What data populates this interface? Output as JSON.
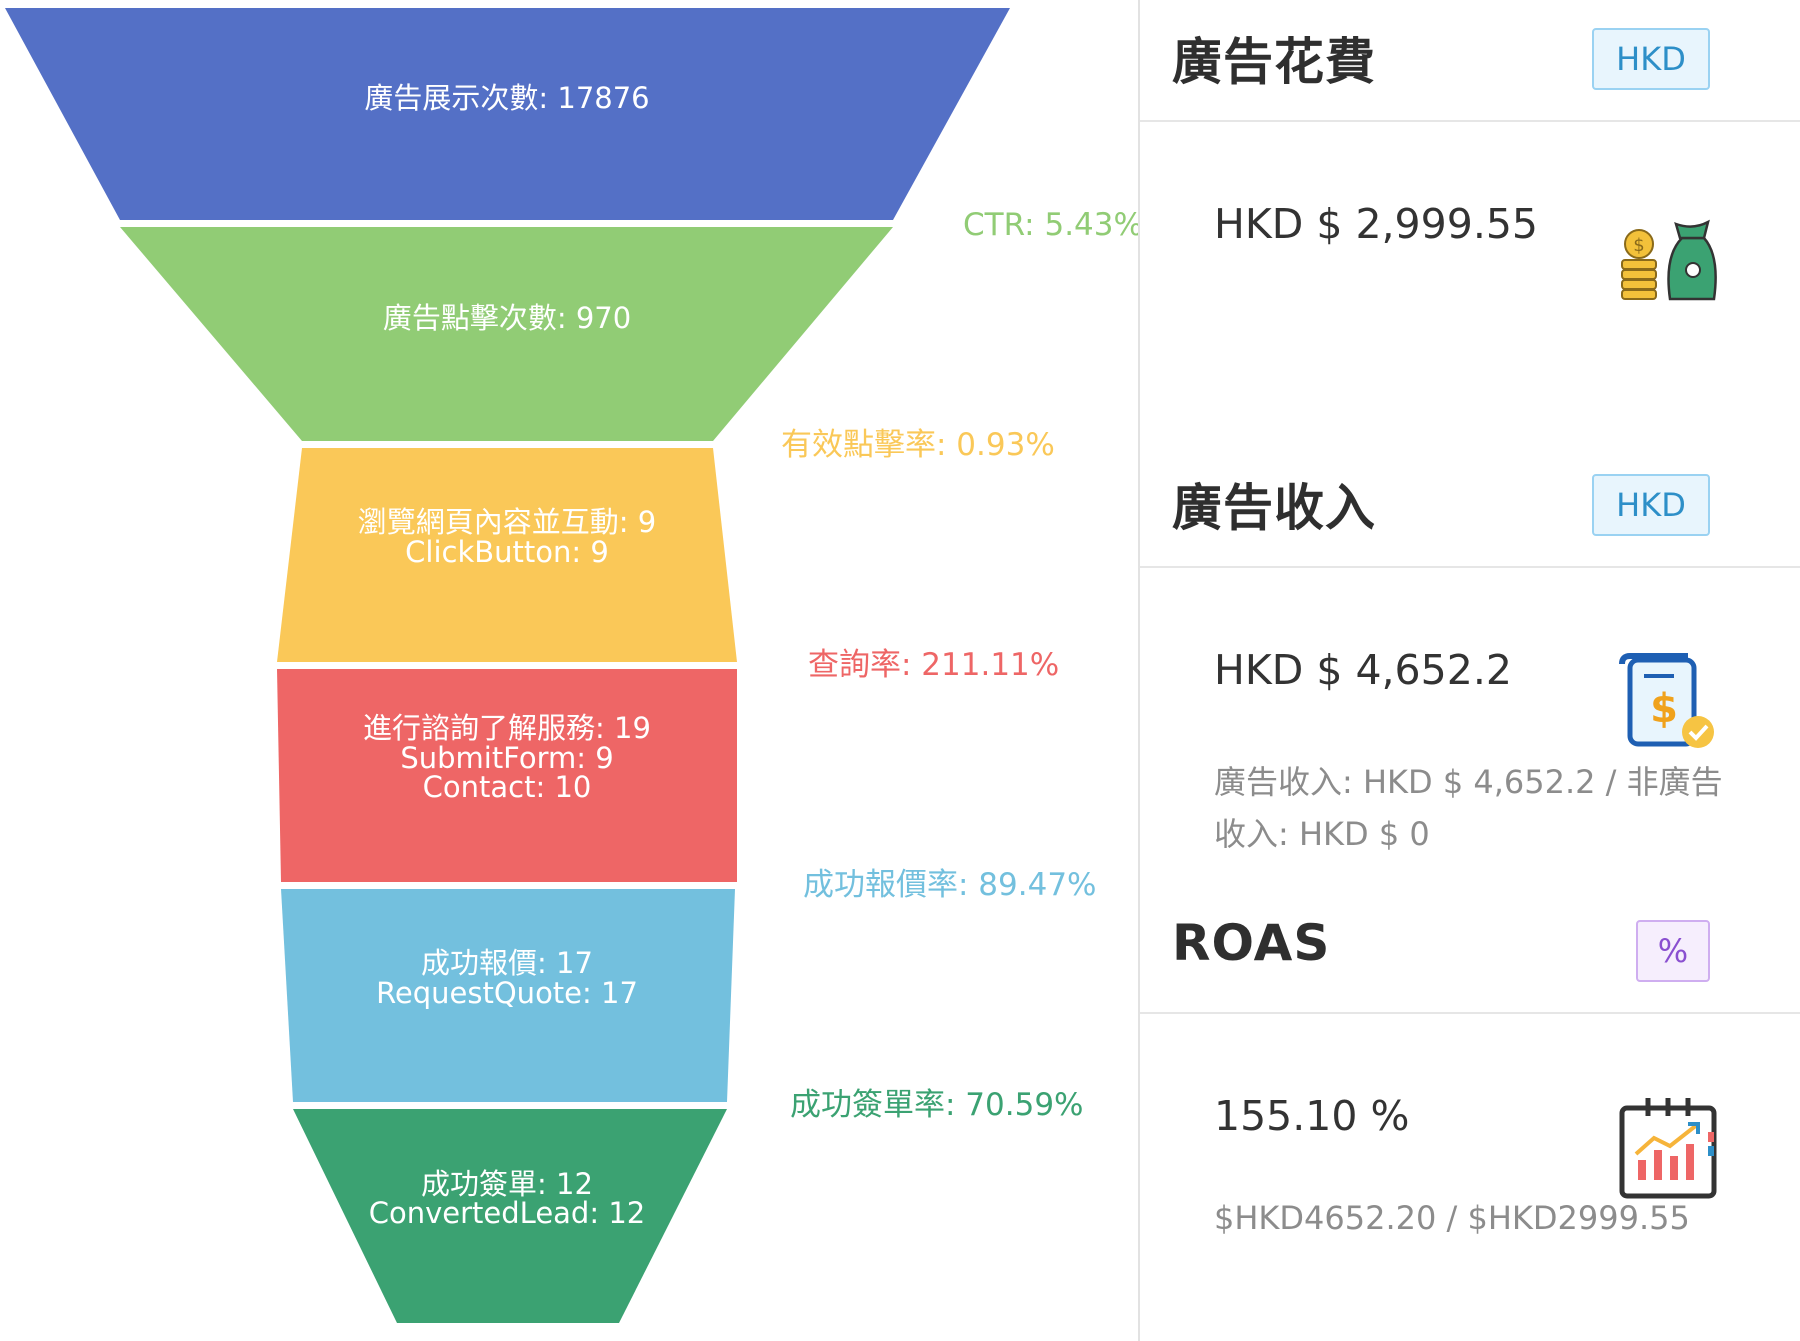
{
  "funnel": {
    "stages": [
      {
        "lines": [
          "廣告展示次數: 17876"
        ],
        "color": "#5470c6"
      },
      {
        "lines": [
          "廣告點擊次數: 970"
        ],
        "color": "#91cc75"
      },
      {
        "lines": [
          "瀏覽網頁內容並互動: 9",
          "ClickButton: 9"
        ],
        "color": "#fac858"
      },
      {
        "lines": [
          "進行諮詢了解服務: 19",
          "SubmitForm: 9",
          "Contact: 10"
        ],
        "color": "#ee6666"
      },
      {
        "lines": [
          "成功報價: 17",
          "RequestQuote: 17"
        ],
        "color": "#73c0de"
      },
      {
        "lines": [
          "成功簽單: 12",
          "ConvertedLead: 12"
        ],
        "color": "#3ba272"
      }
    ],
    "rates": [
      {
        "label": "CTR: 5.43%",
        "color": "#91cc75"
      },
      {
        "label": "有效點擊率: 0.93%",
        "color": "#fac858"
      },
      {
        "label": "查詢率: 211.11%",
        "color": "#ee6666"
      },
      {
        "label": "成功報價率: 89.47%",
        "color": "#73c0de"
      },
      {
        "label": "成功簽單率: 70.59%",
        "color": "#3ba272"
      }
    ]
  },
  "cards": {
    "spend": {
      "title": "廣告花費",
      "badge": "HKD",
      "value": "HKD $ 2,999.55",
      "icon": "money-bag-coins-icon"
    },
    "revenue": {
      "title": "廣告收入",
      "badge": "HKD",
      "value": "HKD $ 4,652.2",
      "sub": "廣告收入: HKD $ 4,652.2 / 非廣告收入: HKD $ 0",
      "icon": "invoice-dollar-check-icon"
    },
    "roas": {
      "title": "ROAS",
      "badge": "%",
      "value": "155.10 %",
      "sub": "$HKD4652.20 / $HKD2999.55",
      "icon": "calendar-chart-icon"
    }
  }
}
